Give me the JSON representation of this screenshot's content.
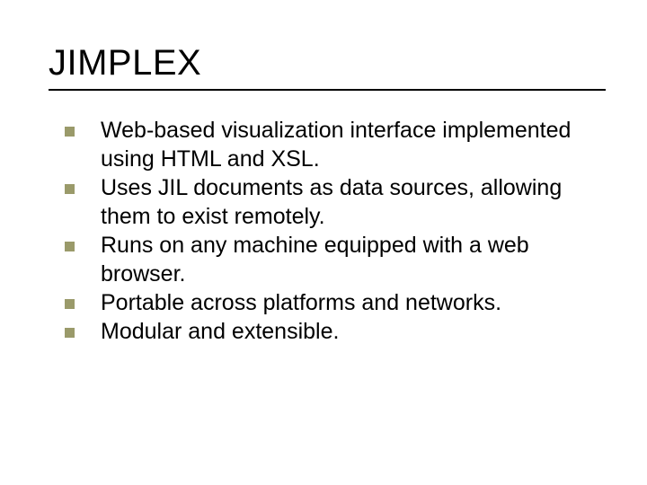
{
  "slide": {
    "title": "JIMPLEX",
    "bullets": [
      "Web-based visualization interface implemented using HTML and XSL.",
      "Uses JIL documents as data sources, allowing them to exist remotely.",
      "Runs on any machine equipped with a web browser.",
      "Portable across platforms and networks.",
      "Modular and extensible."
    ]
  }
}
